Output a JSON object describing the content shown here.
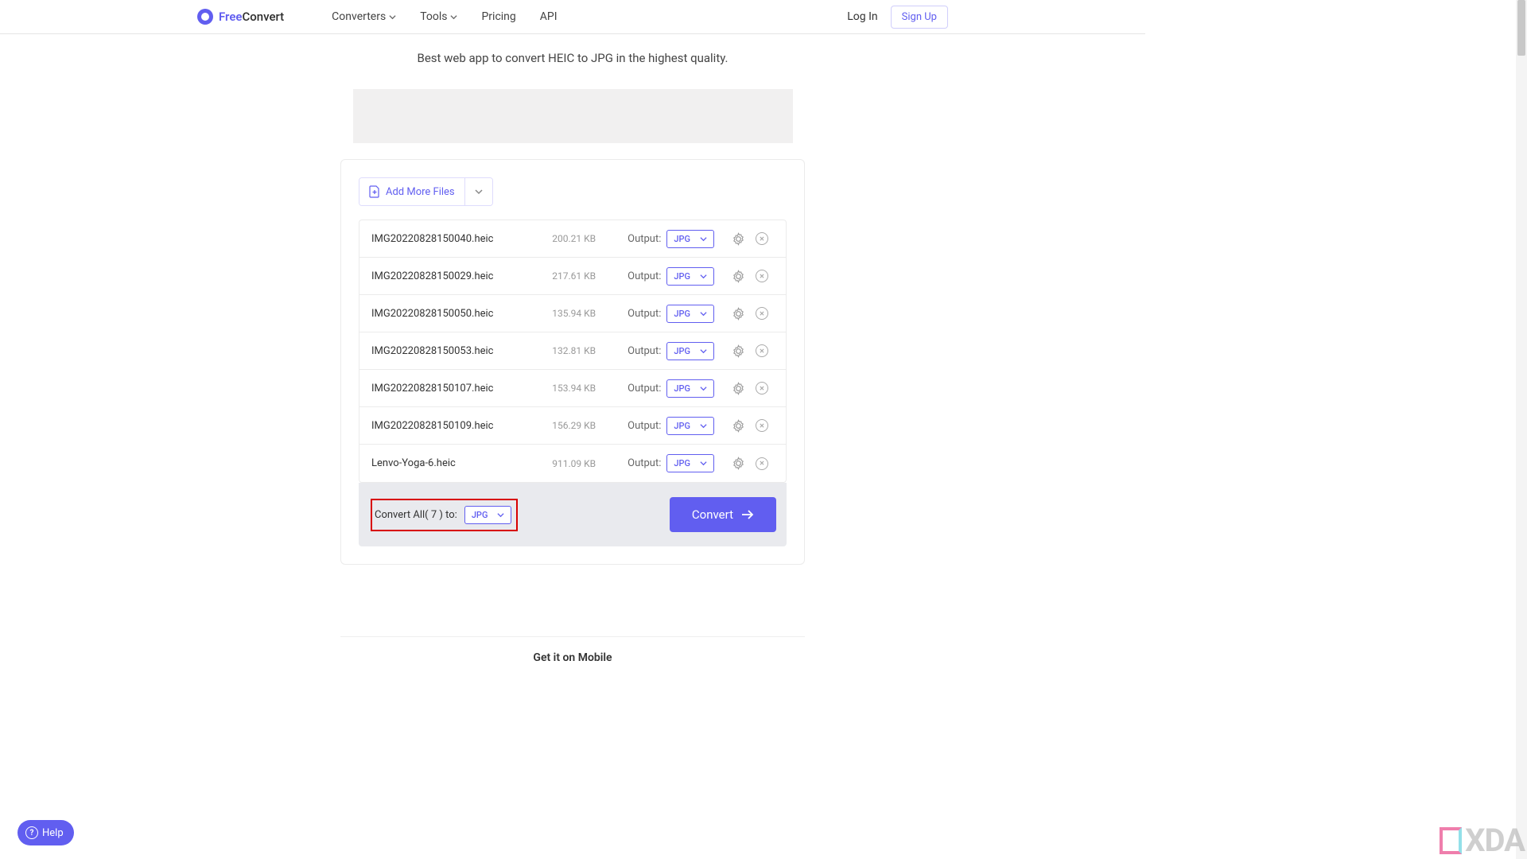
{
  "brand": {
    "free": "Free",
    "convert": "Convert"
  },
  "nav": {
    "converters": "Converters",
    "tools": "Tools",
    "pricing": "Pricing",
    "api": "API"
  },
  "auth": {
    "login": "Log In",
    "signup": "Sign Up"
  },
  "subtitle": "Best web app to convert HEIC to JPG in the highest quality.",
  "addMore": "Add More Files",
  "outputLabel": "Output:",
  "files": [
    {
      "name": "IMG20220828150040.heic",
      "size": "200.21 KB",
      "format": "JPG"
    },
    {
      "name": "IMG20220828150029.heic",
      "size": "217.61 KB",
      "format": "JPG"
    },
    {
      "name": "IMG20220828150050.heic",
      "size": "135.94 KB",
      "format": "JPG"
    },
    {
      "name": "IMG20220828150053.heic",
      "size": "132.81 KB",
      "format": "JPG"
    },
    {
      "name": "IMG20220828150107.heic",
      "size": "153.94 KB",
      "format": "JPG"
    },
    {
      "name": "IMG20220828150109.heic",
      "size": "156.29 KB",
      "format": "JPG"
    },
    {
      "name": "Lenvo-Yoga-6.heic",
      "size": "911.09 KB",
      "format": "JPG"
    }
  ],
  "convertAll": {
    "label": "Convert All( 7 ) to:",
    "format": "JPG"
  },
  "convertBtn": "Convert",
  "mobile": {
    "title": "Get it on Mobile"
  },
  "help": "Help",
  "watermark": "XDA"
}
